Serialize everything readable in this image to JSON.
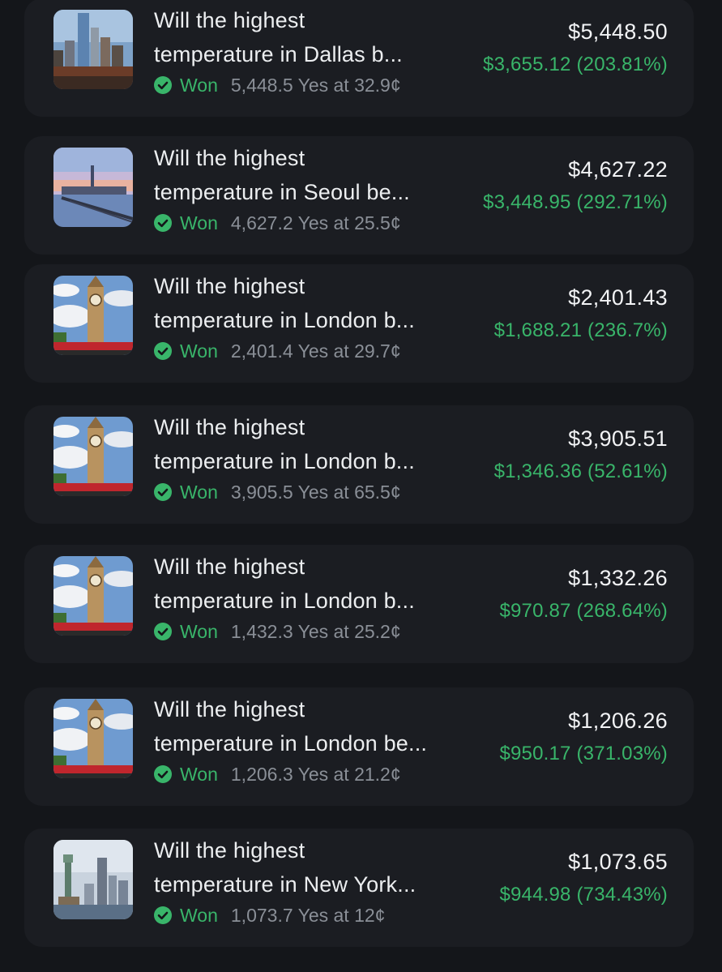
{
  "colors": {
    "background": "#14161a",
    "card": "#1b1d22",
    "won_green": "#39b56a",
    "muted": "#8a8f97",
    "text": "#eceef0"
  },
  "positions": [
    {
      "title_line1": "Will the highest",
      "title_line2": "temperature in Dallas b...",
      "status": "Won",
      "shares": "5,448.5 Yes at 32.9¢",
      "value": "$5,448.50",
      "pnl": "$3,655.12 (203.81%)",
      "thumbnail_icon": "dallas-skyline-image"
    },
    {
      "title_line1": "Will the highest",
      "title_line2": "temperature in Seoul be...",
      "status": "Won",
      "shares": "4,627.2 Yes at 25.5¢",
      "value": "$4,627.22",
      "pnl": "$3,448.95 (292.71%)",
      "thumbnail_icon": "seoul-skyline-image"
    },
    {
      "title_line1": "Will the highest",
      "title_line2": "temperature in London b...",
      "status": "Won",
      "shares": "2,401.4 Yes at 29.7¢",
      "value": "$2,401.43",
      "pnl": "$1,688.21 (236.7%)",
      "thumbnail_icon": "big-ben-image"
    },
    {
      "title_line1": "Will the highest",
      "title_line2": "temperature in London b...",
      "status": "Won",
      "shares": "3,905.5 Yes at 65.5¢",
      "value": "$3,905.51",
      "pnl": "$1,346.36 (52.61%)",
      "thumbnail_icon": "big-ben-image"
    },
    {
      "title_line1": "Will the highest",
      "title_line2": "temperature in London b...",
      "status": "Won",
      "shares": "1,432.3 Yes at 25.2¢",
      "value": "$1,332.26",
      "pnl": "$970.87 (268.64%)",
      "thumbnail_icon": "big-ben-image"
    },
    {
      "title_line1": "Will the highest",
      "title_line2": "temperature in London be...",
      "status": "Won",
      "shares": "1,206.3 Yes at 21.2¢",
      "value": "$1,206.26",
      "pnl": "$950.17 (371.03%)",
      "thumbnail_icon": "big-ben-image"
    },
    {
      "title_line1": "Will the highest",
      "title_line2": "temperature in New York...",
      "status": "Won",
      "shares": "1,073.7 Yes at 12¢",
      "value": "$1,073.65",
      "pnl": "$944.98 (734.43%)",
      "thumbnail_icon": "statue-of-liberty-image"
    }
  ]
}
